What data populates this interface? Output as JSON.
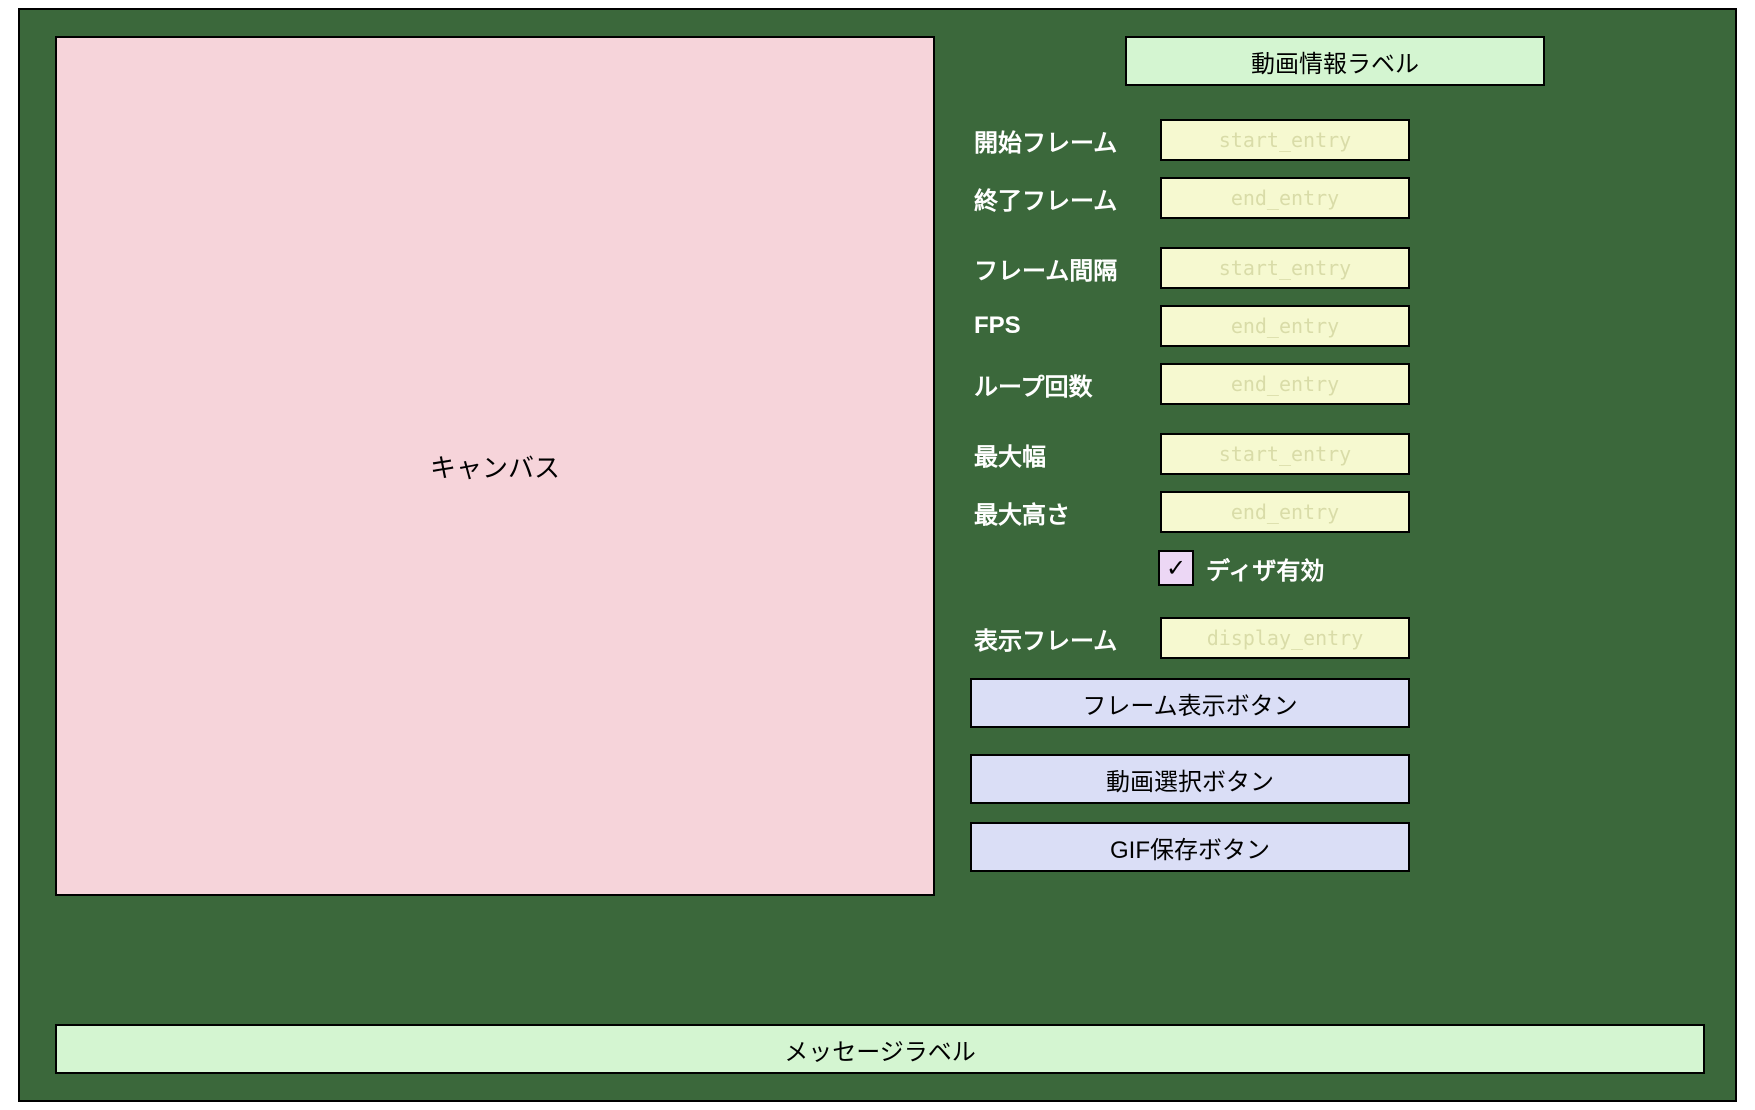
{
  "canvas": {
    "label": "キャンバス"
  },
  "panel": {
    "info_label": "動画情報ラベル",
    "fields": {
      "start_frame": {
        "label": "開始フレーム",
        "placeholder": "start_entry"
      },
      "end_frame": {
        "label": "終了フレーム",
        "placeholder": "end_entry"
      },
      "frame_interval": {
        "label": "フレーム間隔",
        "placeholder": "start_entry"
      },
      "fps": {
        "label": "FPS",
        "placeholder": "end_entry"
      },
      "loop_count": {
        "label": "ループ回数",
        "placeholder": "end_entry"
      },
      "max_width": {
        "label": "最大幅",
        "placeholder": "start_entry"
      },
      "max_height": {
        "label": "最大高さ",
        "placeholder": "end_entry"
      },
      "display_frame": {
        "label": "表示フレーム",
        "placeholder": "display_entry"
      }
    },
    "dither": {
      "label": "ディザ有効",
      "checked": "✓"
    },
    "buttons": {
      "show_frame": "フレーム表示ボタン",
      "select_video": "動画選択ボタン",
      "save_gif": "GIF保存ボタン"
    }
  },
  "message_label": "メッセージラベル"
}
